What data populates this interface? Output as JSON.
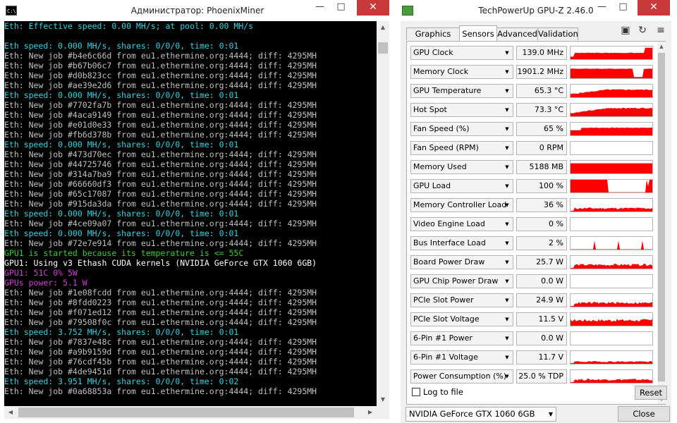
{
  "console": {
    "title": "Администратор:  PhoenixMiner",
    "icon_text": "C:\\.",
    "lines": [
      {
        "text": "Eth: Effective speed: 0.00 MH/s; at pool: 0.00 MH/s",
        "color": "cyan"
      },
      {
        "text": "",
        "color": "gray"
      },
      {
        "text": "Eth speed: 0.000 MH/s, shares: 0/0/0, time: 0:01",
        "color": "cyan"
      },
      {
        "text": "Eth: New job #b4e6c66d from eu1.ethermine.org:4444; diff: 4295MH",
        "color": "gray"
      },
      {
        "text": "Eth: New job #b67b06c7 from eu1.ethermine.org:4444; diff: 4295MH",
        "color": "gray"
      },
      {
        "text": "Eth: New job #d0b823cc from eu1.ethermine.org:4444; diff: 4295MH",
        "color": "gray"
      },
      {
        "text": "Eth: New job #ae39e2d6 from eu1.ethermine.org:4444; diff: 4295MH",
        "color": "gray"
      },
      {
        "text": "Eth speed: 0.000 MH/s, shares: 0/0/0, time: 0:01",
        "color": "cyan"
      },
      {
        "text": "Eth: New job #7702fa7b from eu1.ethermine.org:4444; diff: 4295MH",
        "color": "gray"
      },
      {
        "text": "Eth: New job #4aca9149 from eu1.ethermine.org:4444; diff: 4295MH",
        "color": "gray"
      },
      {
        "text": "Eth: New job #e01d0e33 from eu1.ethermine.org:4444; diff: 4295MH",
        "color": "gray"
      },
      {
        "text": "Eth: New job #fb6d378b from eu1.ethermine.org:4444; diff: 4295MH",
        "color": "gray"
      },
      {
        "text": "Eth speed: 0.000 MH/s, shares: 0/0/0, time: 0:01",
        "color": "cyan"
      },
      {
        "text": "Eth: New job #473d70ec from eu1.ethermine.org:4444; diff: 4295MH",
        "color": "gray"
      },
      {
        "text": "Eth: New job #44725746 from eu1.ethermine.org:4444; diff: 4295MH",
        "color": "gray"
      },
      {
        "text": "Eth: New job #314a7ba9 from eu1.ethermine.org:4444; diff: 4295MH",
        "color": "gray"
      },
      {
        "text": "Eth: New job #66660df3 from eu1.ethermine.org:4444; diff: 4295MH",
        "color": "gray"
      },
      {
        "text": "Eth: New job #65c17087 from eu1.ethermine.org:4444; diff: 4295MH",
        "color": "gray"
      },
      {
        "text": "Eth: New job #915da3da from eu1.ethermine.org:4444; diff: 4295MH",
        "color": "gray"
      },
      {
        "text": "Eth speed: 0.000 MH/s, shares: 0/0/0, time: 0:01",
        "color": "cyan"
      },
      {
        "text": "Eth: New job #4ce09a07 from eu1.ethermine.org:4444; diff: 4295MH",
        "color": "gray"
      },
      {
        "text": "Eth speed: 0.000 MH/s, shares: 0/0/0, time: 0:01",
        "color": "cyan"
      },
      {
        "text": "Eth: New job #72e7e914 from eu1.ethermine.org:4444; diff: 4295MH",
        "color": "gray"
      },
      {
        "text": "GPU1 is started because its temperature is <= 55C",
        "color": "green"
      },
      {
        "text": "GPU1: Using v3 Ethash CUDA kernels (NVIDIA GeForce GTX 1060 6GB)",
        "color": "white"
      },
      {
        "text": "GPU1: 51C 0% 5W",
        "color": "magenta"
      },
      {
        "text": "GPUs power: 5.1 W",
        "color": "magenta"
      },
      {
        "text": "Eth: New job #1e08fcdd from eu1.ethermine.org:4444; diff: 4295MH",
        "color": "gray"
      },
      {
        "text": "Eth: New job #8fdd0223 from eu1.ethermine.org:4444; diff: 4295MH",
        "color": "gray"
      },
      {
        "text": "Eth: New job #f071ed12 from eu1.ethermine.org:4444; diff: 4295MH",
        "color": "gray"
      },
      {
        "text": "Eth: New job #79508f0c from eu1.ethermine.org:4444; diff: 4295MH",
        "color": "gray"
      },
      {
        "text": "Eth speed: 3.752 MH/s, shares: 0/0/0, time: 0:01",
        "color": "cyan"
      },
      {
        "text": "Eth: New job #7837e48c from eu1.ethermine.org:4444; diff: 4295MH",
        "color": "gray"
      },
      {
        "text": "Eth: New job #a9b9159d from eu1.ethermine.org:4444; diff: 4295MH",
        "color": "gray"
      },
      {
        "text": "Eth: New job #76cdf45b from eu1.ethermine.org:4444; diff: 4295MH",
        "color": "gray"
      },
      {
        "text": "Eth: New job #4de9451d from eu1.ethermine.org:4444; diff: 4295MH",
        "color": "gray"
      },
      {
        "text": "Eth speed: 3.951 MH/s, shares: 0/0/0, time: 0:02",
        "color": "cyan"
      },
      {
        "text": "Eth: New job #0a68853a from eu1.ethermine.org:4444; diff: 4295MH",
        "color": "gray"
      }
    ],
    "colors": {
      "cyan": "#33d3e0",
      "gray": "#c0c0c0",
      "green": "#33d033",
      "white": "#ffffff",
      "magenta": "#d040d0"
    }
  },
  "gpuz": {
    "title": "TechPowerUp GPU-Z 2.46.0",
    "tabs": [
      "Graphics Card",
      "Sensors",
      "Advanced",
      "Validation"
    ],
    "active_tab": "Sensors",
    "toolbar_icons": [
      "camera-icon",
      "refresh-icon",
      "menu-icon"
    ],
    "graph_color": "#ff0000",
    "sensors": [
      {
        "label": "GPU Clock",
        "value": "139.0 MHz",
        "level": 0.5,
        "shape": "steady-spike"
      },
      {
        "label": "Memory Clock",
        "value": "1901.2 MHz",
        "level": 0.75,
        "shape": "full-dip"
      },
      {
        "label": "GPU Temperature",
        "value": "65.3 °C",
        "level": 0.6,
        "shape": "rising"
      },
      {
        "label": "Hot Spot",
        "value": "73.3 °C",
        "level": 0.65,
        "shape": "rising"
      },
      {
        "label": "Fan Speed (%)",
        "value": "65 %",
        "level": 0.6,
        "shape": "step-up"
      },
      {
        "label": "Fan Speed (RPM)",
        "value": "0 RPM",
        "level": 0,
        "shape": "none"
      },
      {
        "label": "Memory Used",
        "value": "5188 MB",
        "level": 0.8,
        "shape": "full"
      },
      {
        "label": "GPU Load",
        "value": "100 %",
        "level": 1.0,
        "shape": "full-gap"
      },
      {
        "label": "Memory Controller Load",
        "value": "36 %",
        "level": 0.3,
        "shape": "low-noise"
      },
      {
        "label": "Video Engine Load",
        "value": "0 %",
        "level": 0,
        "shape": "none"
      },
      {
        "label": "Bus Interface Load",
        "value": "2 %",
        "level": 0.1,
        "shape": "spikes"
      },
      {
        "label": "Board Power Draw",
        "value": "25.7 W",
        "level": 0.35,
        "shape": "low-noise"
      },
      {
        "label": "GPU Chip Power Draw",
        "value": "0.0 W",
        "level": 0,
        "shape": "none"
      },
      {
        "label": "PCIe Slot Power",
        "value": "24.9 W",
        "level": 0.35,
        "shape": "low-noise"
      },
      {
        "label": "PCIe Slot Voltage",
        "value": "11.5 V",
        "level": 0.45,
        "shape": "mid-noise"
      },
      {
        "label": "6-Pin #1 Power",
        "value": "0.0 W",
        "level": 0,
        "shape": "none"
      },
      {
        "label": "6-Pin #1 Voltage",
        "value": "11.7 V",
        "level": 0.2,
        "shape": "low-noise"
      },
      {
        "label": "Power Consumption (%)",
        "value": "25.0 % TDP",
        "level": 0.3,
        "shape": "low-noise"
      }
    ],
    "log_to_file": "Log to file",
    "reset_label": "Reset",
    "device_select": "NVIDIA GeForce GTX 1060 6GB",
    "close_label": "Close"
  }
}
